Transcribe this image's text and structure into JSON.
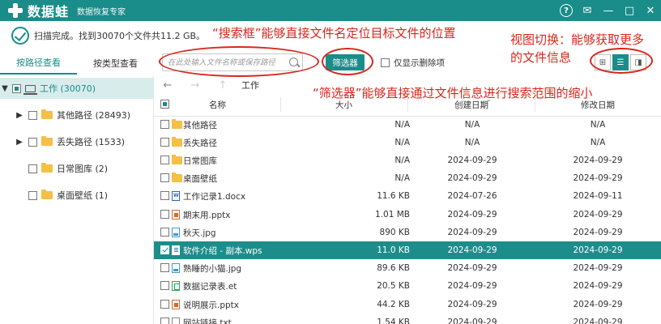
{
  "app": {
    "logo_text": "数据蛙",
    "subtitle": "数据恢复专家"
  },
  "window": {
    "help": "?",
    "feedback": "✉",
    "minimize": "—",
    "maximize": "□",
    "close": "✕"
  },
  "status": {
    "text": "扫描完成。找到30070个文件共11.2 GB。"
  },
  "annotations": {
    "search": "“搜索框”能够直接文件名定位目标文件的位置",
    "view_line1": "视图切换：能够获取更多",
    "view_line2": "的文件信息",
    "filter": "“筛选器”能够直接通过文件信息进行搜索范围的缩小"
  },
  "left_tabs": [
    {
      "label": "按路径查看",
      "active": true
    },
    {
      "label": "按类型查看",
      "active": false
    }
  ],
  "tree": [
    {
      "label": "工作 (30070)",
      "level": 0,
      "expanded": true,
      "selected": true
    },
    {
      "label": "其他路径 (28493)",
      "level": 1,
      "expanded": false
    },
    {
      "label": "丢失路径 (1533)",
      "level": 1,
      "expanded": false
    },
    {
      "label": "日常图库 (2)",
      "level": 1,
      "expanded": null
    },
    {
      "label": "桌面壁纸 (1)",
      "level": 1,
      "expanded": null
    }
  ],
  "toolbar": {
    "search_placeholder": "在此处输入文件名称或保存路径",
    "filter_label": "筛选器",
    "show_deleted_label": "仅显示删除项",
    "view_modes": [
      "thumbnail",
      "list",
      "detail"
    ],
    "view_icons": [
      "⊞",
      "☰",
      "◨"
    ]
  },
  "nav": {
    "back": "←",
    "forward": "→",
    "up": "↑",
    "path": "工作"
  },
  "table": {
    "headers": {
      "name": "名称",
      "size": "大小",
      "created": "创建日期",
      "modified": "修改日期"
    },
    "rows": [
      {
        "name": "其他路径",
        "type": "folder",
        "size": "N/A",
        "created": "N/A",
        "modified": "N/A"
      },
      {
        "name": "丢失路径",
        "type": "folder",
        "size": "N/A",
        "created": "N/A",
        "modified": "N/A"
      },
      {
        "name": "日常图库",
        "type": "folder",
        "size": "N/A",
        "created": "2024-09-29",
        "modified": "2024-09-29"
      },
      {
        "name": "桌面壁纸",
        "type": "folder",
        "size": "N/A",
        "created": "2024-09-29",
        "modified": "2024-09-29"
      },
      {
        "name": "工作记录1.docx",
        "type": "docx",
        "size": "11.6 KB",
        "created": "2024-07-26",
        "modified": "2024-09-11"
      },
      {
        "name": "期末用.pptx",
        "type": "pptx",
        "size": "1.01 MB",
        "created": "2024-09-29",
        "modified": "2024-09-29"
      },
      {
        "name": "秋天.jpg",
        "type": "jpg",
        "size": "890 KB",
        "created": "2024-09-29",
        "modified": "2024-09-29"
      },
      {
        "name": "软件介绍 - 副本.wps",
        "type": "wps",
        "size": "11.0 KB",
        "created": "2024-09-29",
        "modified": "2024-09-29",
        "selected": true
      },
      {
        "name": "熟睡的小猫.jpg",
        "type": "jpg",
        "size": "89.6 KB",
        "created": "2024-09-29",
        "modified": "2024-09-29"
      },
      {
        "name": "数据记录表.et",
        "type": "et",
        "size": "20.5 KB",
        "created": "2024-09-29",
        "modified": "2024-09-29"
      },
      {
        "name": "说明展示.pptx",
        "type": "pptx",
        "size": "44.2 KB",
        "created": "2024-09-29",
        "modified": "2024-09-29"
      },
      {
        "name": "网站链接.txt",
        "type": "txt",
        "size": "1.54 KB",
        "created": "2024-09-29",
        "modified": "2024-09-29"
      }
    ]
  },
  "colors": {
    "brand": "#1a8c8a",
    "annotation": "#d9261c"
  }
}
